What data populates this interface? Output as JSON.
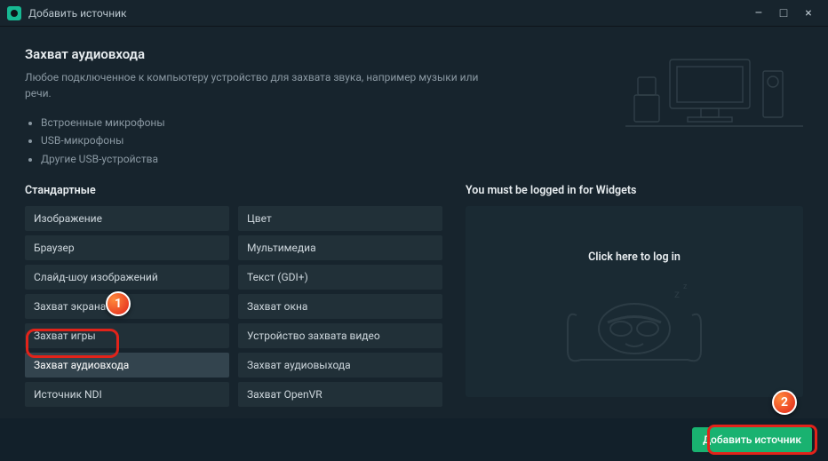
{
  "window": {
    "title": "Добавить источник"
  },
  "header": {
    "title": "Захват аудиовхода",
    "desc": "Любое подключенное к компьютеру устройство для захвата звука, например музыки или речи.",
    "bullets": [
      "Встроенные микрофоны",
      "USB-микрофоны",
      "Другие USB-устройства"
    ]
  },
  "sources": {
    "section_title": "Стандартные",
    "items": [
      {
        "label": "Изображение"
      },
      {
        "label": "Цвет"
      },
      {
        "label": "Браузер"
      },
      {
        "label": "Мультимедиа"
      },
      {
        "label": "Слайд-шоу изображений"
      },
      {
        "label": "Текст (GDI+)"
      },
      {
        "label": "Захват экрана"
      },
      {
        "label": "Захват окна"
      },
      {
        "label": "Захват игры"
      },
      {
        "label": "Устройство захвата видео"
      },
      {
        "label": "Захват аудиовхода",
        "selected": true
      },
      {
        "label": "Захват аудиовыхода"
      },
      {
        "label": "Источник NDI"
      },
      {
        "label": "Захват OpenVR"
      }
    ]
  },
  "widgets": {
    "heading": "You must be logged in for Widgets",
    "login_cta": "Click here to log in"
  },
  "footer": {
    "add_button": "Добавить источник"
  },
  "markers": {
    "one": "1",
    "two": "2"
  },
  "colors": {
    "accent": "#19b270",
    "highlight": "#e2231a",
    "bg": "#17242d"
  }
}
